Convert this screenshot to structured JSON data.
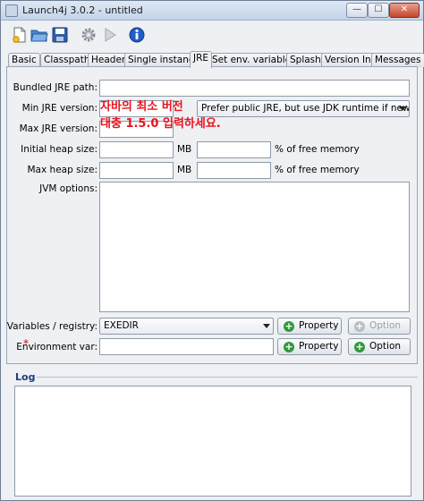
{
  "window": {
    "title": "Launch4j 3.0.2 - untitled",
    "minimize_glyph": "—",
    "maximize_glyph": "☐",
    "close_glyph": "✕"
  },
  "toolbar": {
    "icons": [
      "new-file-icon",
      "open-folder-icon",
      "save-icon",
      "gear-icon",
      "run-icon",
      "info-icon"
    ]
  },
  "tabs": [
    {
      "label": "Basic"
    },
    {
      "label": "Classpath"
    },
    {
      "label": "Header"
    },
    {
      "label": "Single instance"
    },
    {
      "label": "JRE",
      "active": true
    },
    {
      "label": "Set env. variables"
    },
    {
      "label": "Splash"
    },
    {
      "label": "Version Info"
    },
    {
      "label": "Messages"
    }
  ],
  "jre": {
    "bundled_path_label": "Bundled JRE path:",
    "bundled_path_value": "",
    "min_version_label": "Min JRE version:",
    "min_version_value": "",
    "jdk_preference": "Prefer public JRE, but use JDK runtime if newer",
    "max_version_label": "Max JRE version:",
    "max_version_value": "",
    "initial_heap_label": "Initial heap size:",
    "max_heap_label": "Max heap size:",
    "mb_unit": "MB",
    "percent_unit": "% of free memory",
    "jvm_options_label": "JVM options:",
    "variables_label": "Variables / registry:",
    "variables_value": "EXEDIR",
    "property_button": "Property",
    "option_button": "Option",
    "env_var_label": "Environment var:",
    "required_marker": "*"
  },
  "annotation": {
    "line1": "자바의 최소 버전",
    "line2": "대충 1.5.0 입력하세요."
  },
  "log": {
    "label": "Log"
  },
  "colors": {
    "annotation": "#e8141e",
    "log_label": "#1f3d7a",
    "plus_button": "#2f9a3a"
  }
}
